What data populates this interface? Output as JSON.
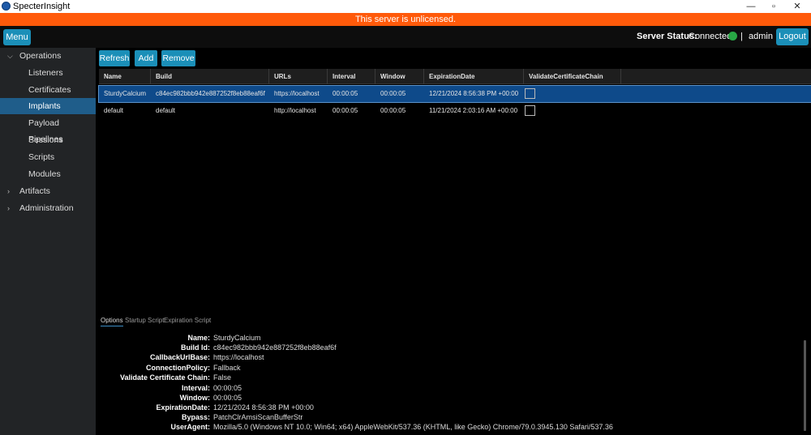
{
  "window": {
    "title": "SpecterInsight",
    "minimize": "—",
    "restore": "▫",
    "close": "✕"
  },
  "banner": "This server is unlicensed.",
  "topbar": {
    "menu_label": "Menu",
    "status_label": "Server Status:",
    "status_value": "Connected",
    "status_color": "#28a745",
    "separator": "|",
    "user": "admin",
    "logout_label": "Logout"
  },
  "sidebar": {
    "operations": {
      "label": "Operations",
      "expanded": true
    },
    "items": [
      {
        "label": "Listeners"
      },
      {
        "label": "Certificates"
      },
      {
        "label": "Implants"
      },
      {
        "label": "Payload Pipelines"
      },
      {
        "label": "Sessions"
      },
      {
        "label": "Scripts"
      },
      {
        "label": "Modules"
      }
    ],
    "artifacts": {
      "label": "Artifacts",
      "expanded": false
    },
    "administration": {
      "label": "Administration",
      "expanded": false
    }
  },
  "toolbar": {
    "refresh": "Refresh",
    "add": "Add",
    "remove": "Remove"
  },
  "grid": {
    "columns": [
      "Name",
      "Build",
      "URLs",
      "Interval",
      "Window",
      "ExpirationDate",
      "ValidateCertificateChain"
    ],
    "rows": [
      {
        "name": "SturdyCalcium",
        "build": "c84ec982bbb942e887252f8eb88eaf6f",
        "urls": "https://localhost",
        "interval": "00:00:05",
        "window": "00:00:05",
        "expiration": "12/21/2024 8:56:38 PM +00:00",
        "validate": false,
        "selected": true
      },
      {
        "name": "default",
        "build": "default",
        "urls": "http://localhost",
        "interval": "00:00:05",
        "window": "00:00:05",
        "expiration": "11/21/2024 2:03:16 AM +00:00",
        "validate": false,
        "selected": false
      }
    ]
  },
  "detail_tabs": [
    "Options",
    "Startup Script",
    "Expiration Script"
  ],
  "details": [
    {
      "key": "Name:",
      "value": "SturdyCalcium"
    },
    {
      "key": "Build Id:",
      "value": "c84ec982bbb942e887252f8eb88eaf6f"
    },
    {
      "key": "CallbackUrlBase:",
      "value": "https://localhost"
    },
    {
      "key": "ConnectionPolicy:",
      "value": "Fallback"
    },
    {
      "key": "Validate Certificate Chain:",
      "value": "False"
    },
    {
      "key": "Interval:",
      "value": "00:00:05"
    },
    {
      "key": "Window:",
      "value": "00:00:05"
    },
    {
      "key": "ExpirationDate:",
      "value": "12/21/2024 8:56:38 PM +00:00"
    },
    {
      "key": "Bypass:",
      "value": "PatchClrAmsiScanBufferStr"
    },
    {
      "key": "UserAgent:",
      "value": "Mozilla/5.0 (Windows NT 10.0; Win64; x64) AppleWebKit/537.36 (KHTML, like Gecko) Chrome/79.0.3945.130 Safari/537.36"
    }
  ]
}
